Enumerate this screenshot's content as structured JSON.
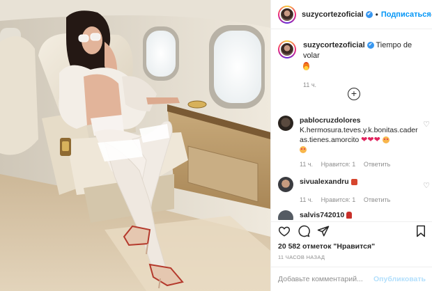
{
  "post": {
    "image_alt": "Woman in white fur coat and stockings seated in a cream leather seat of a private jet cabin"
  },
  "header": {
    "username": "suzycortezoficial",
    "verified": true,
    "separator": "•",
    "follow_label": "Подписаться",
    "more_icon": "more-horizontal-icon"
  },
  "caption": {
    "username": "suzycortezoficial",
    "text": "Tiempo de volar",
    "emoji": "fire",
    "time": "11 ч."
  },
  "load_more_icon": "plus-circle-icon",
  "comments": [
    {
      "username": "pablocruzdolores",
      "text": "K.hermosura.teves.y.k.bonitas.caderas.tienes.amorcito",
      "time": "11 ч.",
      "likes": "Нравится: 1",
      "reply": "Ответить"
    },
    {
      "username": "sivualexandru",
      "text": "",
      "time": "11 ч.",
      "likes": "Нравится: 1",
      "reply": "Ответить"
    },
    {
      "username": "salvis742010",
      "text": ""
    }
  ],
  "actions": {
    "like_icon": "heart-icon",
    "comment_icon": "comment-icon",
    "share_icon": "paper-plane-icon",
    "save_icon": "bookmark-icon"
  },
  "likes_text": "20 582 отметок \"Нравится\"",
  "posted_time": "11 ЧАСОВ НАЗАД",
  "add_comment": {
    "placeholder": "Добавьте комментарий...",
    "publish_label": "Опубликовать"
  },
  "colors": {
    "accent": "#0095f6",
    "publish_disabled": "#b2dffc",
    "muted": "#8e8e8e",
    "verified": "#3897f0"
  }
}
